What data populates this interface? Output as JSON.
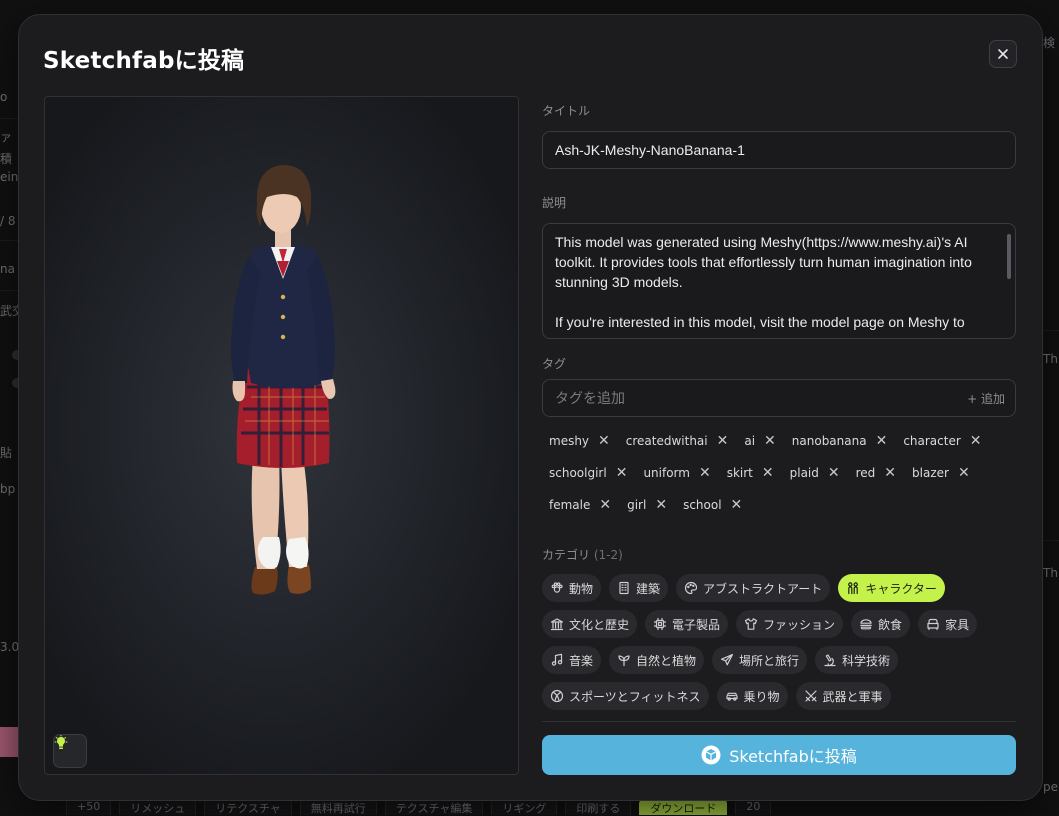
{
  "background": {
    "right_fragments": [
      "検",
      "Thi",
      "Thi",
      "per"
    ],
    "left_fragments": [
      "o",
      "ァ",
      "積",
      "ein",
      "/ 8",
      "na",
      "武交",
      "貼",
      "bp",
      "3.0"
    ],
    "toolbar": [
      "+50",
      "リメッシュ",
      "リテクスチャ",
      "無料再試行",
      "テクスチャ編集",
      "リギング",
      "印刷する",
      "ダウンロード",
      "20"
    ]
  },
  "modal": {
    "title": "Sketchfabに投稿",
    "close_icon": "close-icon"
  },
  "viewer": {
    "light_button_icon": "lightbulb-icon"
  },
  "form": {
    "title_label": "タイトル",
    "title_value": "Ash-JK-Meshy-NanoBanana-1",
    "description_label": "説明",
    "description_paragraph_1": "This model was generated using Meshy(https://www.meshy.ai)'s AI toolkit. It provides tools that effortlessly turn human imagination into stunning 3D models.",
    "description_paragraph_2": "If you're interested in this model, visit the model page on Meshy to",
    "tags_label": "タグ",
    "tags_placeholder": "タグを追加",
    "add_label": "+ 追加",
    "tags": [
      "meshy",
      "createdwithai",
      "ai",
      "nanobanana",
      "character",
      "schoolgirl",
      "uniform",
      "skirt",
      "plaid",
      "red",
      "blazer",
      "female",
      "girl",
      "school"
    ],
    "category_label": "カテゴリ",
    "category_limit": "(1-2)",
    "categories": [
      {
        "label": "動物",
        "icon": "paw-icon",
        "selected": false
      },
      {
        "label": "建築",
        "icon": "building-icon",
        "selected": false
      },
      {
        "label": "アブストラクトアート",
        "icon": "palette-icon",
        "selected": false
      },
      {
        "label": "キャラクター",
        "icon": "character-icon",
        "selected": true
      },
      {
        "label": "文化と歴史",
        "icon": "museum-icon",
        "selected": false
      },
      {
        "label": "電子製品",
        "icon": "chip-icon",
        "selected": false
      },
      {
        "label": "ファッション",
        "icon": "shirt-icon",
        "selected": false
      },
      {
        "label": "飲食",
        "icon": "burger-icon",
        "selected": false
      },
      {
        "label": "家具",
        "icon": "sofa-icon",
        "selected": false
      },
      {
        "label": "音楽",
        "icon": "music-icon",
        "selected": false
      },
      {
        "label": "自然と植物",
        "icon": "plant-icon",
        "selected": false
      },
      {
        "label": "場所と旅行",
        "icon": "plane-icon",
        "selected": false
      },
      {
        "label": "科学技術",
        "icon": "microscope-icon",
        "selected": false
      },
      {
        "label": "スポーツとフィットネス",
        "icon": "ball-icon",
        "selected": false
      },
      {
        "label": "乗り物",
        "icon": "car-icon",
        "selected": false
      },
      {
        "label": "武器と軍事",
        "icon": "swords-icon",
        "selected": false
      }
    ],
    "submit_label": "Sketchfabに投稿",
    "submit_icon": "sketchfab-logo-icon"
  },
  "colors": {
    "accent_lime": "#c4f24a",
    "submit_blue": "#56b3dc",
    "modal_bg": "#1c1c1f"
  }
}
